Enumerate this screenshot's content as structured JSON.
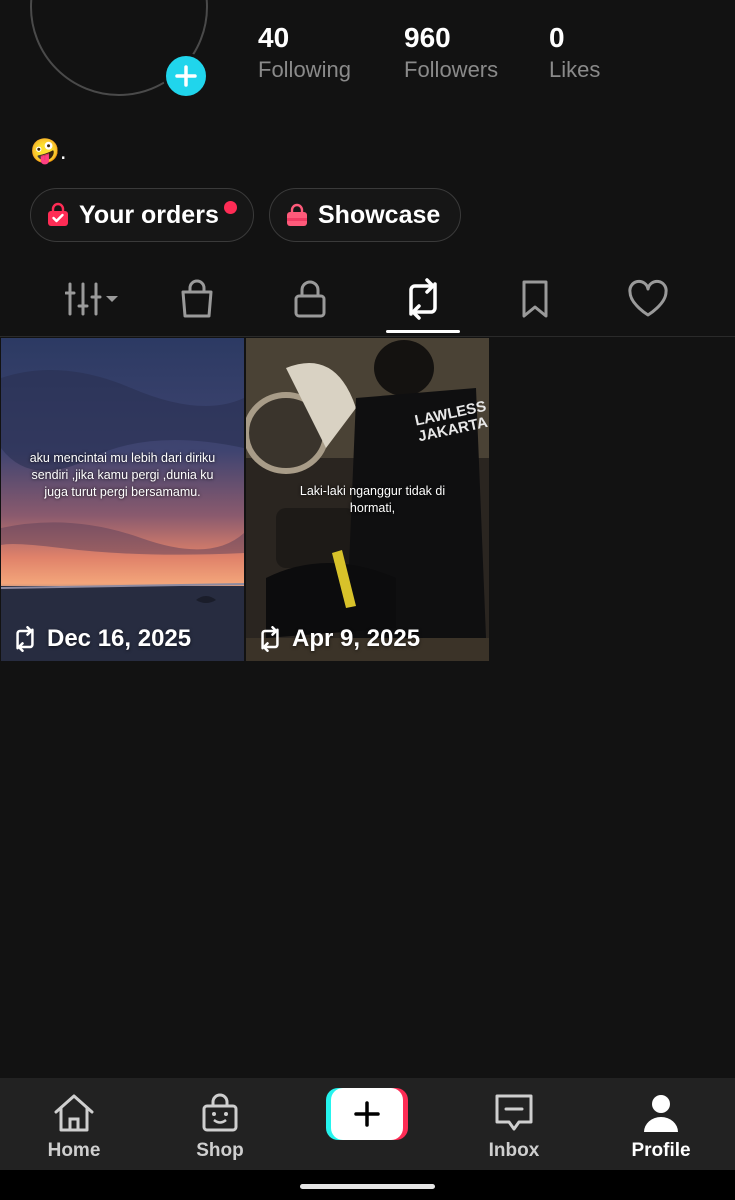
{
  "profile": {
    "bio": "🤪."
  },
  "stats": [
    {
      "value": "40",
      "label": "Following"
    },
    {
      "value": "960",
      "label": "Followers"
    },
    {
      "value": "0",
      "label": "Likes"
    }
  ],
  "pills": {
    "orders": "Your orders",
    "showcase": "Showcase"
  },
  "tabs": {
    "active": "reposts",
    "icons": [
      "grid-filter-icon",
      "shop-bag-icon",
      "lock-icon",
      "repost-icon",
      "bookmark-icon",
      "heart-icon"
    ]
  },
  "videos": [
    {
      "caption": "aku mencintai mu lebih dari diriku sendiri ,jika kamu pergi ,dunia ku juga turut pergi bersamamu.",
      "date": "Dec 16, 2025"
    },
    {
      "caption": "Laki-laki nganggur tidak di hormati,",
      "date": "Apr 9, 2025",
      "shirt_text": "LAWLESS JAKARTA"
    }
  ],
  "nav": {
    "home": "Home",
    "shop": "Shop",
    "inbox": "Inbox",
    "profile": "Profile"
  },
  "colors": {
    "accent_cyan": "#20d5ec",
    "accent_red": "#fe2c55",
    "background": "#121212"
  }
}
